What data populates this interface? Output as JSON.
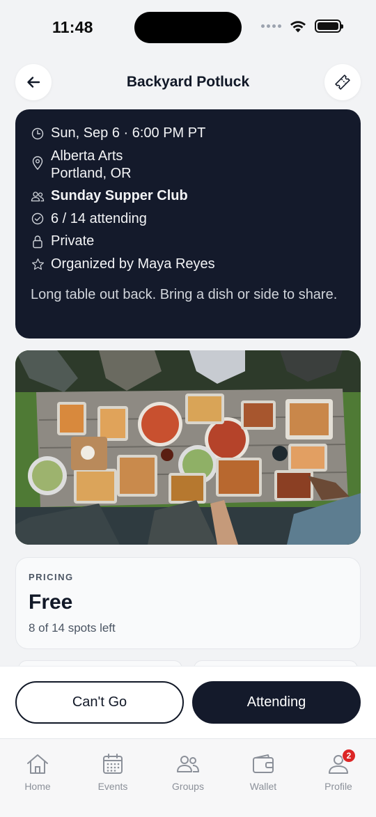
{
  "status_bar": {
    "time": "11:48",
    "icons": [
      "cellular-dots-icon",
      "wifi-icon",
      "battery-icon"
    ],
    "battery_level": 1.0
  },
  "header": {
    "title": "Backyard Potluck",
    "back_icon": "arrow-left-icon",
    "ticket_icon": "ticket-icon"
  },
  "event": {
    "datetime": "Sun, Sep 6 · 6:00 PM PT",
    "location_line1": "Alberta Arts",
    "location_line2": "Portland, OR",
    "group": "Sunday Supper Club",
    "attendance": "6 / 14 attending",
    "visibility": "Private",
    "organizer": "Organized by Maya Reyes",
    "description": "Long table out back. Bring a dish or side to share."
  },
  "photo": {
    "icon": "potluck-table-photo"
  },
  "pricing": {
    "label": "PRICING",
    "value": "Free",
    "spots": "8 of 14 spots left"
  },
  "actions": {
    "cant_go": "Can't Go",
    "attending": "Attending"
  },
  "tabs": [
    {
      "label": "Home",
      "icon": "home-icon"
    },
    {
      "label": "Events",
      "icon": "calendar-icon"
    },
    {
      "label": "Groups",
      "icon": "people-icon"
    },
    {
      "label": "Wallet",
      "icon": "wallet-icon"
    },
    {
      "label": "Profile",
      "icon": "person-icon",
      "badge": "2"
    }
  ],
  "colors": {
    "dark": "#141a2b",
    "background": "#f2f3f5",
    "badge": "#dc2626",
    "tab_inactive": "#8b9099"
  }
}
